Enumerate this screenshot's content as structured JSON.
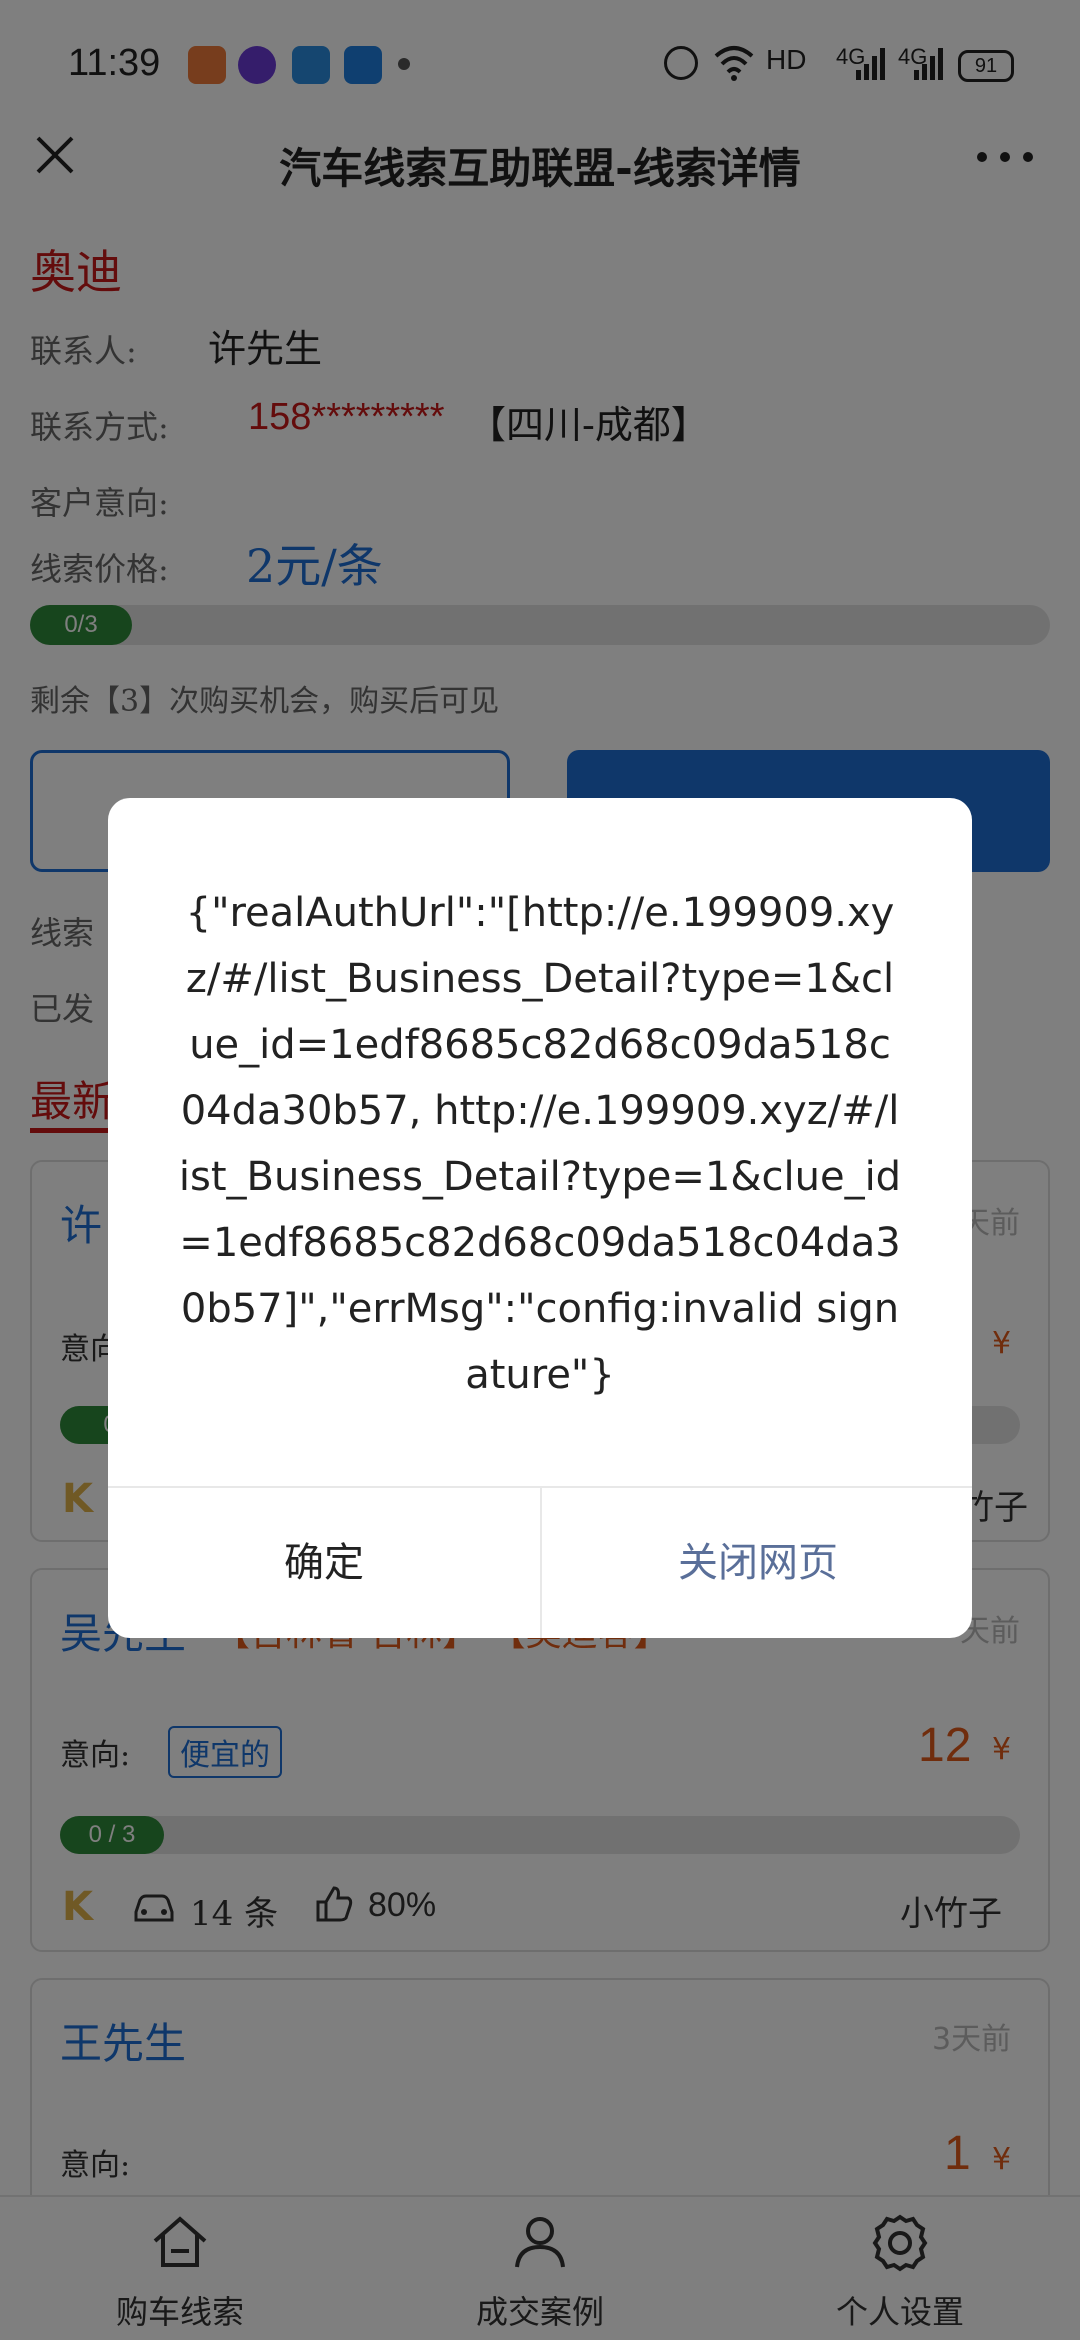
{
  "status_bar": {
    "time": "11:39",
    "network_label": "HD",
    "signal1": "4G",
    "signal2": "4G",
    "battery": "91"
  },
  "header": {
    "title": "汽车线索互助联盟-线索详情"
  },
  "detail": {
    "brand": "奥迪",
    "contact_label": "联系人:",
    "contact_value": "许先生",
    "phone_label": "联系方式:",
    "phone_value": "158*********",
    "region": "【四川-成都】",
    "intent_label": "客户意向:",
    "price_label": "线索价格:",
    "price_value": "2元/条",
    "progress_text": "0/3",
    "progress_fraction": 0.0,
    "remaining_text": "剩余【3】次购买机会，购买后可见",
    "clue_row_prefix": "线索",
    "sent_row_prefix": "已发"
  },
  "latest": {
    "section_title_visible": "最新"
  },
  "cards": [
    {
      "name_visible": "许",
      "time_visible": "天前",
      "intent_label": "意向",
      "price_yen": "¥",
      "progress_visible": "0",
      "seller_visible": "竹子"
    },
    {
      "name_visible": "吴先生",
      "bracket_text": "【吉林省-吉林】 【奥迪客】",
      "time_visible": "天前",
      "intent_label": "意向:",
      "tag": "便宜的",
      "price": "12",
      "yen": "¥",
      "progress_text": "0 / 3",
      "count_text": "14 条",
      "rate_text": "80%",
      "seller": "小竹子"
    },
    {
      "name": "王先生",
      "time": "3天前",
      "intent_label": "意向:",
      "price": "1",
      "yen": "¥"
    }
  ],
  "bottom_nav": [
    {
      "label": "购车线索",
      "icon": "home-icon"
    },
    {
      "label": "成交案例",
      "icon": "person-icon"
    },
    {
      "label": "个人设置",
      "icon": "gear-icon"
    }
  ],
  "dialog": {
    "message": "{\"realAuthUrl\":\"[http://e.199909.xyz/#/list_Business_Detail?type=1&clue_id=1edf8685c82d68c09da518c04da30b57, http://e.199909.xyz/#/list_Business_Detail?type=1&clue_id=1edf8685c82d68c09da518c04da30b57]\",\"errMsg\":\"config:invalid signature\"}",
    "confirm_label": "确定",
    "close_label": "关闭网页"
  },
  "colors": {
    "accent_blue": "#1f6ed4",
    "brand_red": "#c81818",
    "progress_green": "#2f8a3a",
    "price_orange": "#e05a1a",
    "dialog_close_text": "#5a6f99"
  }
}
